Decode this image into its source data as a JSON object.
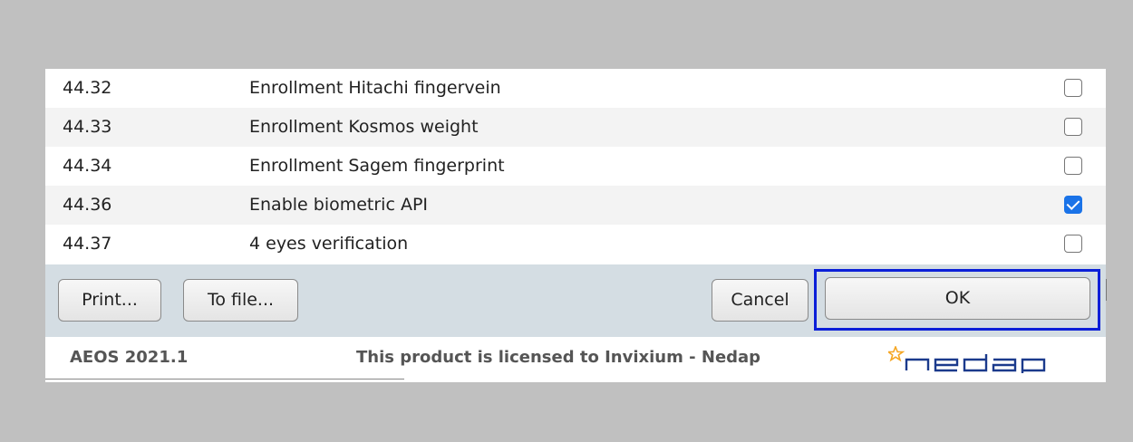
{
  "rows": [
    {
      "number": "44.32",
      "label": "Enrollment Hitachi fingervein",
      "checked": false
    },
    {
      "number": "44.33",
      "label": "Enrollment Kosmos weight",
      "checked": false
    },
    {
      "number": "44.34",
      "label": "Enrollment Sagem fingerprint",
      "checked": false
    },
    {
      "number": "44.36",
      "label": "Enable biometric API",
      "checked": true
    },
    {
      "number": "44.37",
      "label": "4 eyes verification",
      "checked": false
    }
  ],
  "toolbar": {
    "print_label": "Print...",
    "file_label": "To file...",
    "cancel_label": "Cancel",
    "ok_label": "OK"
  },
  "footer": {
    "version": "AEOS 2021.1",
    "license": "This product is licensed to Invixium - Nedap",
    "logo_text": "nedap"
  },
  "colors": {
    "background": "#c0c0c0",
    "toolbar": "#d4dde3",
    "focus_frame": "#0b1fd8",
    "checkbox_checked": "#1a73e8",
    "logo_star": "#f5a623"
  }
}
